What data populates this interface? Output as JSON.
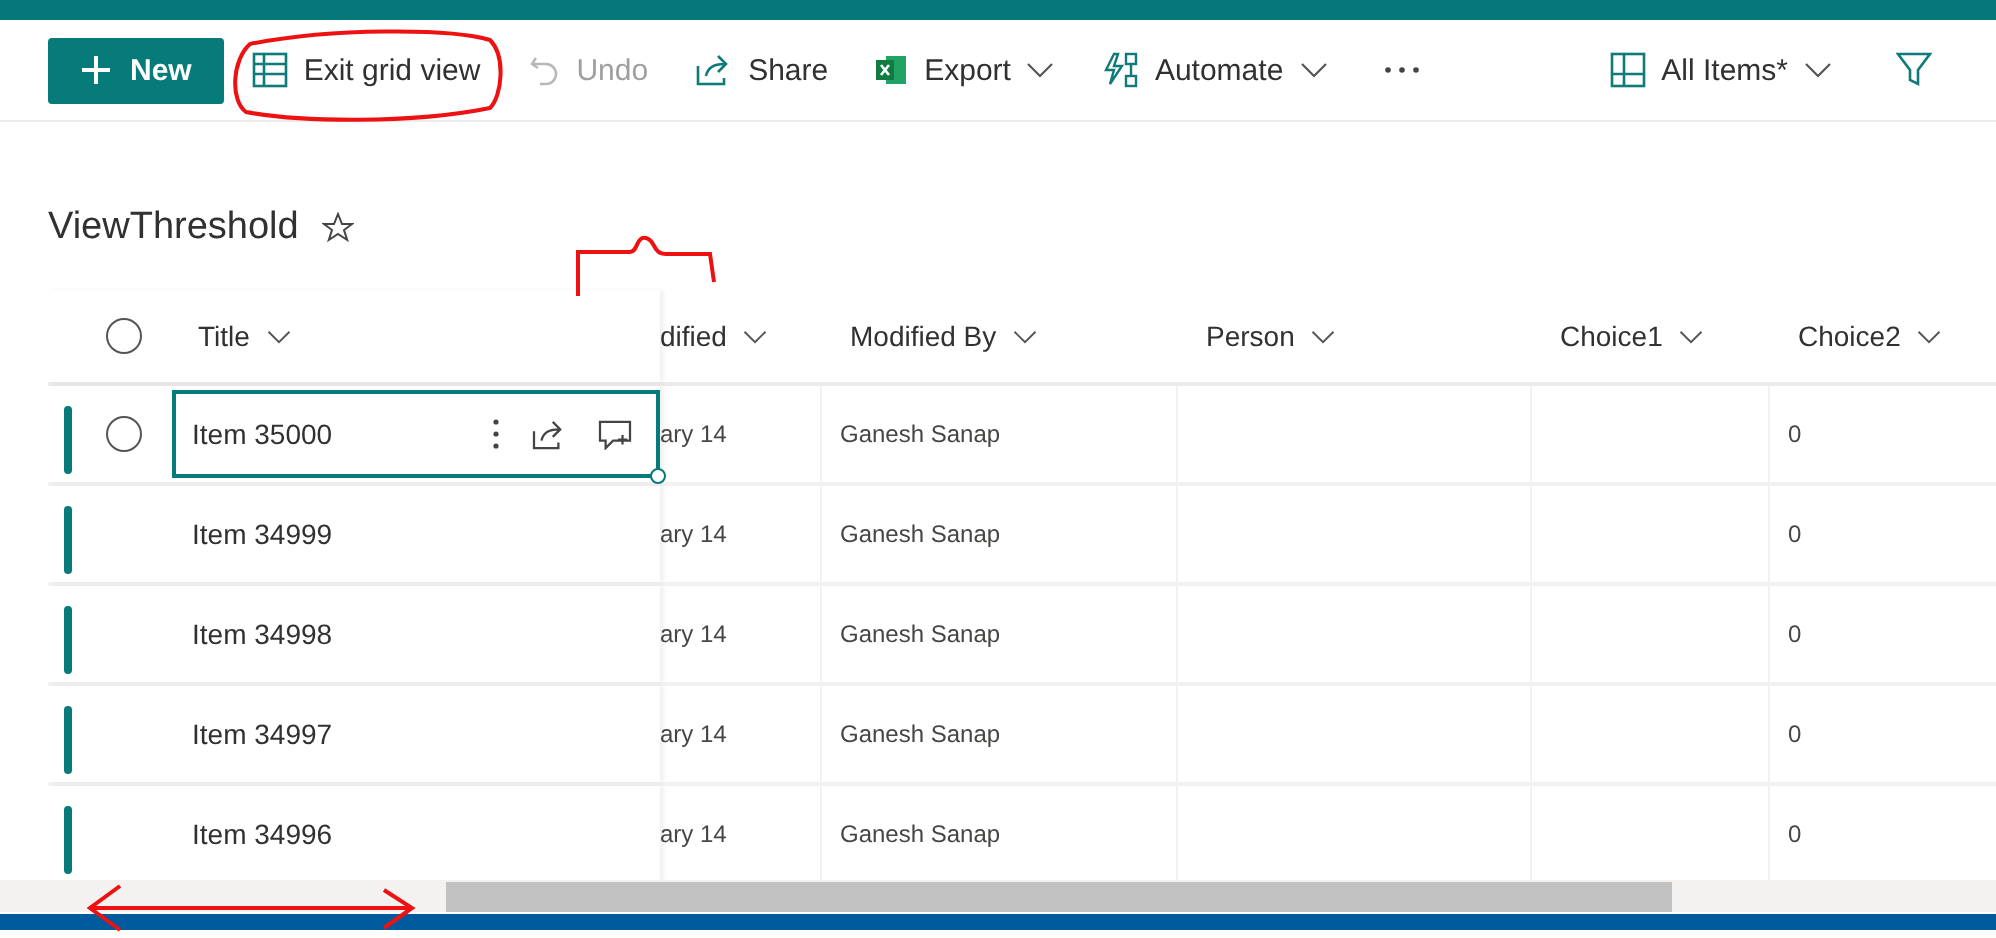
{
  "toolbar": {
    "new_button": {
      "label": "New"
    },
    "items": [
      {
        "kind": "grid",
        "label": "Exit grid view",
        "disabled": false,
        "dropdown": false
      },
      {
        "kind": "undo",
        "label": "Undo",
        "disabled": true,
        "dropdown": false
      },
      {
        "kind": "share",
        "label": "Share",
        "disabled": false,
        "dropdown": false
      },
      {
        "kind": "excel",
        "label": "Export",
        "disabled": false,
        "dropdown": true
      },
      {
        "kind": "automate",
        "label": "Automate",
        "disabled": false,
        "dropdown": true
      }
    ],
    "view_selector": {
      "label": "All Items*"
    }
  },
  "page": {
    "title": "ViewThreshold",
    "favorite": false
  },
  "table": {
    "all_selected": false,
    "columns": [
      {
        "label": "Title"
      },
      {
        "label": "dified"
      },
      {
        "label": "Modified By"
      },
      {
        "label": "Person"
      },
      {
        "label": "Choice1"
      },
      {
        "label": "Choice2"
      }
    ],
    "rows": [
      {
        "title": "Item 35000",
        "focused": true,
        "modified": "ary 14",
        "modified_by": "Ganesh Sanap",
        "choice2": "0"
      },
      {
        "title": "Item 34999",
        "focused": false,
        "modified": "ary 14",
        "modified_by": "Ganesh Sanap",
        "choice2": "0"
      },
      {
        "title": "Item 34998",
        "focused": false,
        "modified": "ary 14",
        "modified_by": "Ganesh Sanap",
        "choice2": "0"
      },
      {
        "title": "Item 34997",
        "focused": false,
        "modified": "ary 14",
        "modified_by": "Ganesh Sanap",
        "choice2": "0"
      },
      {
        "title": "Item 34996",
        "focused": false,
        "modified": "ary 14",
        "modified_by": "Ganesh Sanap",
        "choice2": "0"
      }
    ]
  }
}
